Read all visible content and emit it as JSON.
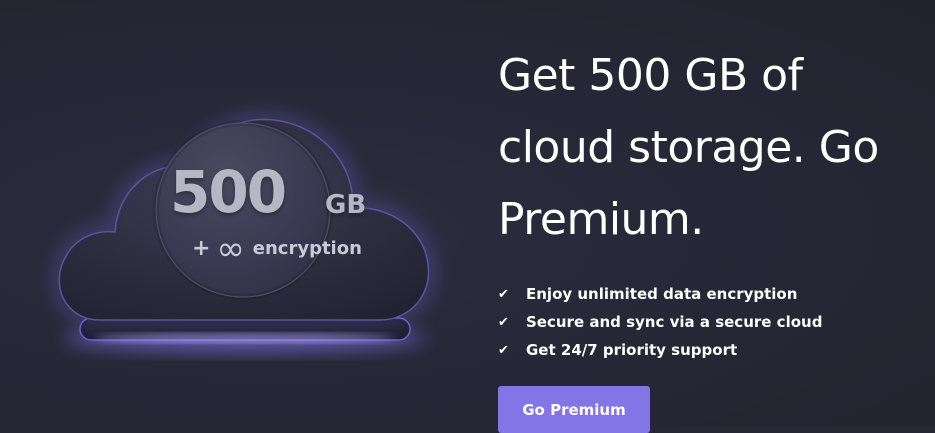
{
  "hero": {
    "storage_number": "500",
    "storage_unit": "GB",
    "extra_plus": "+",
    "extra_icon": "infinity-icon",
    "extra_label": "encryption"
  },
  "headline": "Get 500 GB of cloud storage. Go Premium.",
  "features": [
    {
      "icon": "check-icon",
      "label": "Enjoy unlimited data encryption"
    },
    {
      "icon": "check-icon",
      "label": "Secure and sync via a secure cloud"
    },
    {
      "icon": "check-icon",
      "label": "Get 24/7 priority support"
    }
  ],
  "cta": {
    "label": "Go Premium"
  },
  "colors": {
    "background": "#262635",
    "accent": "#8375e6",
    "glow": "#8a7cff",
    "text": "#ffffff"
  }
}
